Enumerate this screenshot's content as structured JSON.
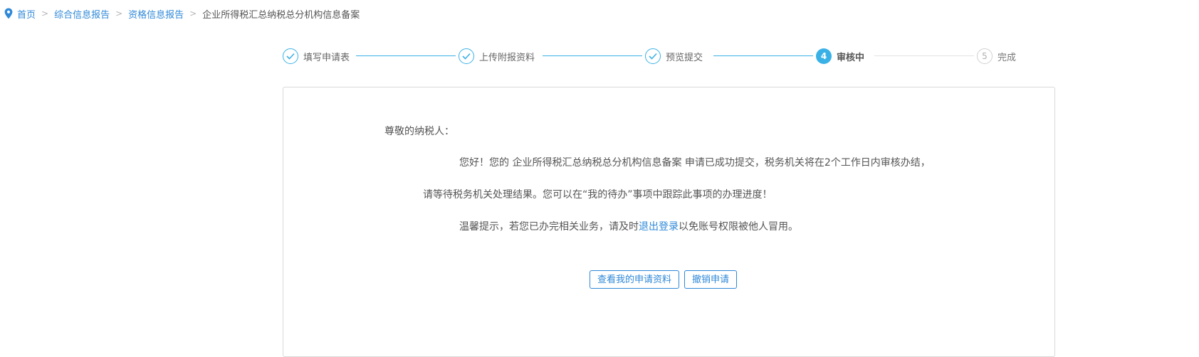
{
  "breadcrumb": {
    "icon": "location-pin-icon",
    "items": [
      "首页",
      "综合信息报告",
      "资格信息报告"
    ],
    "separator": ">",
    "current": "企业所得税汇总纳税总分机构信息备案"
  },
  "steps": [
    {
      "label": "填写申请表",
      "state": "done",
      "marker": "✓"
    },
    {
      "label": "上传附报资料",
      "state": "done",
      "marker": "✓"
    },
    {
      "label": "预览提交",
      "state": "done",
      "marker": "✓"
    },
    {
      "label": "审核中",
      "state": "active",
      "marker": "4"
    },
    {
      "label": "完成",
      "state": "todo",
      "marker": "5"
    }
  ],
  "message": {
    "greeting": "尊敬的纳税人：",
    "line1_prefix": "您好！您的",
    "line1_item": "企业所得税汇总纳税总分机构信息备案",
    "line1_suffix": "申请已成功提交，税务机关将在2个工作日内审核办结，",
    "line2": "请等待税务机关处理结果。您可以在“我的待办”事项中跟踪此事项的办理进度！",
    "line3_prefix": "温馨提示，若您已办完相关业务，请及时",
    "line3_link": "退出登录",
    "line3_suffix": "以免账号权限被他人冒用。"
  },
  "buttons": {
    "view": "查看我的申请资料",
    "revoke": "撤销申请"
  },
  "colors": {
    "link": "#2f88d8",
    "step_accent": "#3ab1e6",
    "border": "#d9d9d9"
  }
}
